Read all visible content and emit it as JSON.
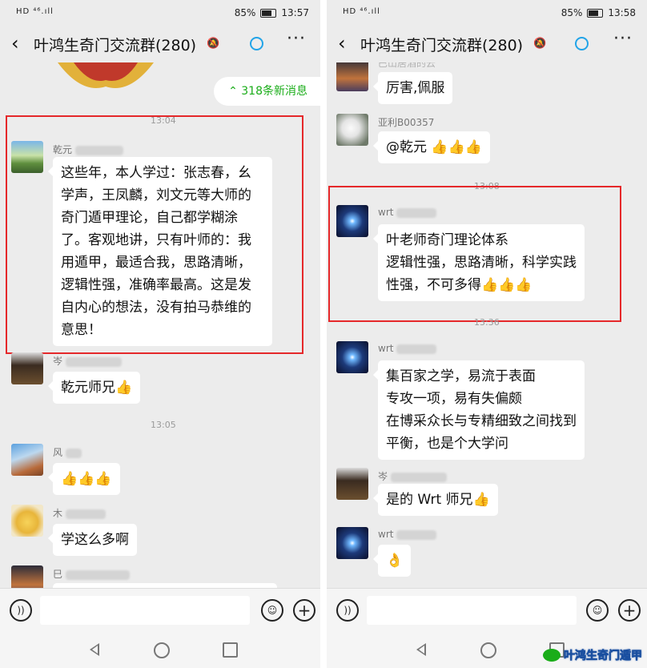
{
  "left": {
    "status": {
      "network": "HD ⁴⁶.ıll",
      "battery": "85%",
      "time": "13:57"
    },
    "header": {
      "title": "叶鸿生奇门交流群(280)",
      "more": "···"
    },
    "new_messages": "⌃ 318条新消息",
    "messages": [
      {
        "time": "13:04"
      },
      {
        "name": "乾元",
        "lines": [
          "这些年，本人学过：张志春，幺",
          "学声，王凤麟，刘文元等大师的",
          "奇门遁甲理论，自己都学糊涂",
          "了。客观地讲，只有叶师的：我",
          "用遁甲，最适合我，思路清晰，",
          "逻辑性强，准确率最高。这是发",
          "自内心的想法，没有拍马恭维的",
          "意思！"
        ]
      },
      {
        "name": "岑",
        "lines": [
          "乾元师兄👍"
        ]
      },
      {
        "time": "13:05"
      },
      {
        "name": "风",
        "lines": [
          "👍👍👍"
        ]
      },
      {
        "name": "木",
        "lines": [
          "学这么多啊"
        ]
      },
      {
        "name": "巳"
      }
    ]
  },
  "right": {
    "status": {
      "network": "HD ⁴⁶.ıll",
      "battery": "85%",
      "time": "13:58"
    },
    "header": {
      "title": "叶鸿生奇门交流群(280)",
      "more": "···"
    },
    "messages": [
      {
        "name": "巴山居酒的云",
        "lines": [
          "厉害,佩服"
        ]
      },
      {
        "name": "亚利B00357",
        "lines": [
          "@乾元 👍👍👍"
        ]
      },
      {
        "time": "13:08"
      },
      {
        "name": "wrt",
        "lines": [
          "叶老师奇门理论体系",
          "逻辑性强，思路清晰，科学实践",
          "性强，不可多得👍👍👍"
        ]
      },
      {
        "time": "13:36"
      },
      {
        "name": "wrt",
        "lines": [
          "集百家之学，易流于表面",
          "专攻一项，易有失偏颇",
          "在博采众长与专精细致之间找到",
          "平衡，也是个大学问"
        ]
      },
      {
        "name": "岑",
        "lines": [
          "是的 Wrt 师兄👍"
        ]
      },
      {
        "name": "wrt",
        "lines": [
          "👌"
        ]
      }
    ]
  },
  "watermark": "叶鸿生奇门遁甲",
  "colors": {
    "accent": "#1aad19",
    "highlight": "#e5282a",
    "bg": "#ececec"
  }
}
